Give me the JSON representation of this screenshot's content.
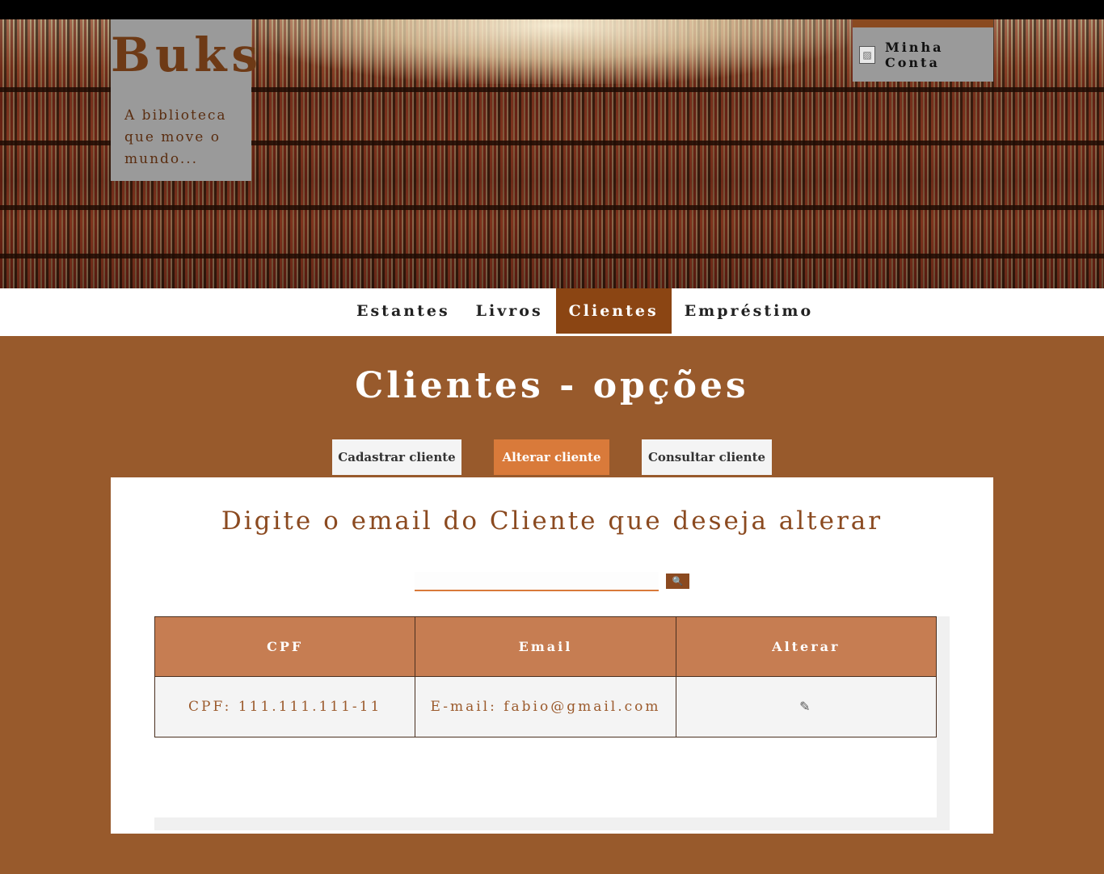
{
  "brand": {
    "title": "Buks",
    "subtitle": "A biblioteca que move o mundo..."
  },
  "account": {
    "label": "Minha Conta",
    "icon": "broken-image-icon"
  },
  "nav": {
    "items": [
      {
        "label": "Estantes"
      },
      {
        "label": "Livros"
      },
      {
        "label": "Clientes"
      },
      {
        "label": "Empréstimo"
      }
    ],
    "active": "Clientes"
  },
  "page": {
    "title": "Clientes - opções"
  },
  "subnav": {
    "cadastrar": "Cadastrar cliente",
    "alterar": "Alterar cliente",
    "consultar": "Consultar cliente",
    "active": "Alterar cliente"
  },
  "card": {
    "title": "Digite o email do Cliente que deseja alterar"
  },
  "search": {
    "value": "",
    "placeholder": "",
    "button_icon": "🔍"
  },
  "table": {
    "headers": [
      "CPF",
      "Email",
      "Alterar"
    ],
    "rows": [
      {
        "cpf": "CPF: 111.111.111-11",
        "email": "E-mail: fabio@gmail.com",
        "edit_icon": "✎"
      }
    ]
  },
  "colors": {
    "brown": "#8b4513",
    "background": "#985a2c",
    "accent": "#d97a3a",
    "table_header": "#c67d52"
  }
}
